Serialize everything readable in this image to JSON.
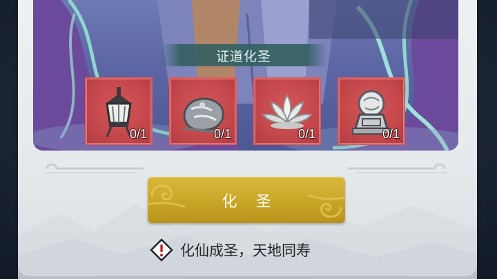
{
  "banner": {
    "title": "证道化圣"
  },
  "items": [
    {
      "name": "lantern",
      "icon": "lantern-icon",
      "count": "0/1"
    },
    {
      "name": "ore",
      "icon": "ore-stone-icon",
      "count": "0/1"
    },
    {
      "name": "lotus",
      "icon": "lotus-icon",
      "count": "0/1"
    },
    {
      "name": "seal",
      "icon": "orb-seal-icon",
      "count": "0/1"
    }
  ],
  "action": {
    "label": "化 圣"
  },
  "hint": {
    "icon": "warning-diamond-icon",
    "text": "化仙成圣，天地同寿"
  },
  "colors": {
    "slot_bg": "#c4474b",
    "button_gold": "#c9a526",
    "banner_teal": "#346062"
  }
}
